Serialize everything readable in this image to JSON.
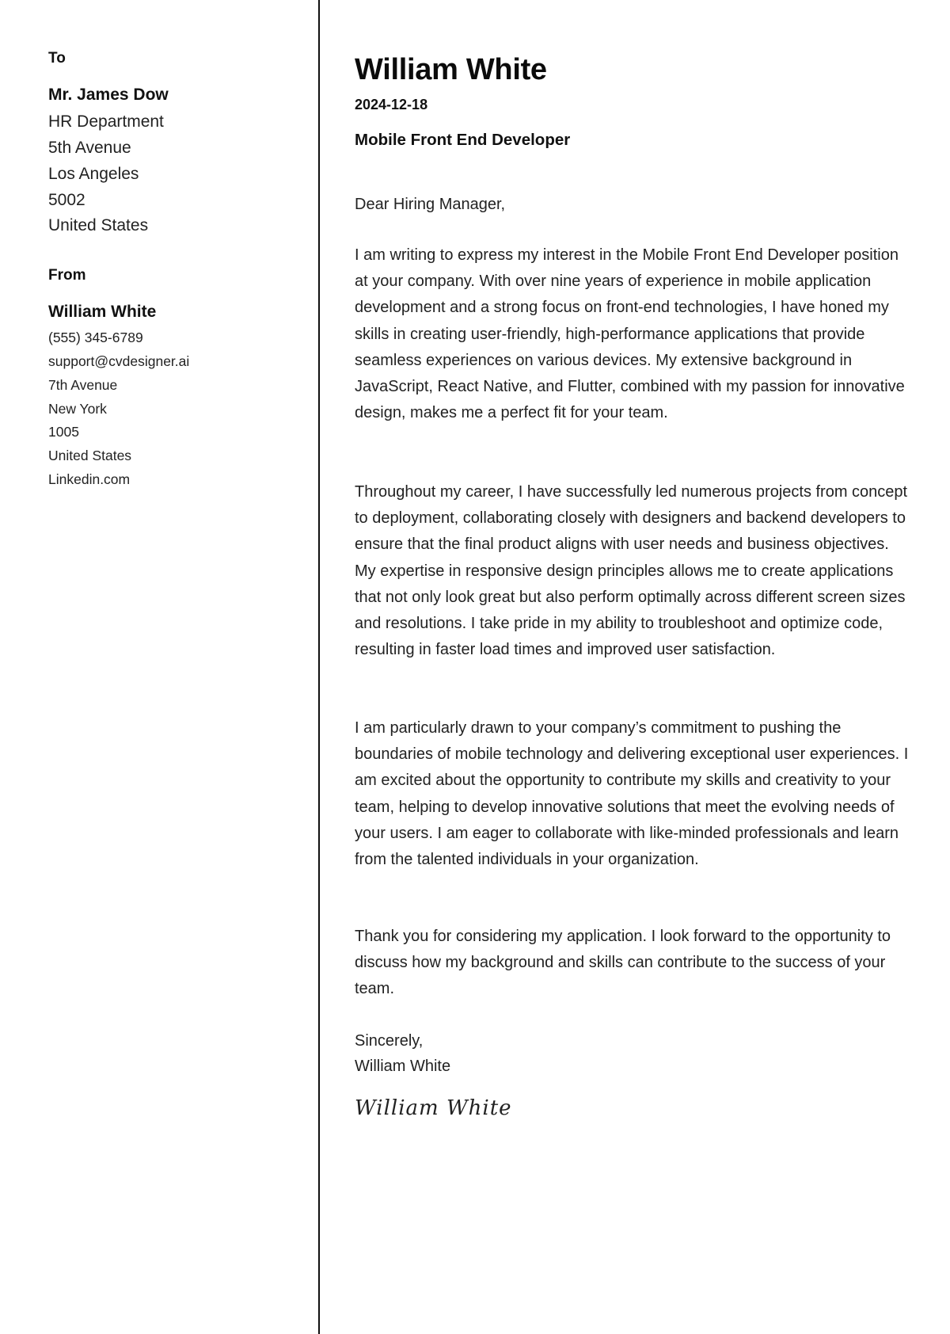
{
  "recipient": {
    "section_label": "To",
    "name": "Mr. James Dow",
    "lines": [
      "HR Department",
      "5th Avenue",
      "Los Angeles",
      "5002",
      "United States"
    ]
  },
  "sender": {
    "section_label": "From",
    "name": "William White",
    "phone": "(555) 345-6789",
    "email": "support@cvdesigner.ai",
    "street": "7th Avenue",
    "city": "New York",
    "zip": "1005",
    "country": "United States",
    "website": "Linkedin.com"
  },
  "letter": {
    "author_name": "William White",
    "date": "2024-12-18",
    "job_title": "Mobile Front End Developer",
    "salutation": "Dear Hiring Manager,",
    "paragraphs": [
      "I am writing to express my interest in the Mobile Front End Developer position at your company. With over nine years of experience in mobile application development and a strong focus on front-end technologies, I have honed my skills in creating user-friendly, high-performance applications that provide seamless experiences on various devices. My extensive background in JavaScript, React Native, and Flutter, combined with my passion for innovative design, makes me a perfect fit for your team.",
      "Throughout my career, I have successfully led numerous projects from concept to deployment, collaborating closely with designers and backend developers to ensure that the final product aligns with user needs and business objectives. My expertise in responsive design principles allows me to create applications that not only look great but also perform optimally across different screen sizes and resolutions. I take pride in my ability to troubleshoot and optimize code, resulting in faster load times and improved user satisfaction.",
      "I am particularly drawn to your company’s commitment to pushing the boundaries of mobile technology and delivering exceptional user experiences. I am excited about the opportunity to contribute my skills and creativity to your team, helping to develop innovative solutions that meet the evolving needs of your users. I am eager to collaborate with like-minded professionals and learn from the talented individuals in your organization.",
      "Thank you for considering my application. I look forward to the opportunity to discuss how my background and skills can contribute to the success of your team."
    ],
    "closing": "Sincerely,",
    "closing_name": "William White",
    "signature": "William White"
  }
}
